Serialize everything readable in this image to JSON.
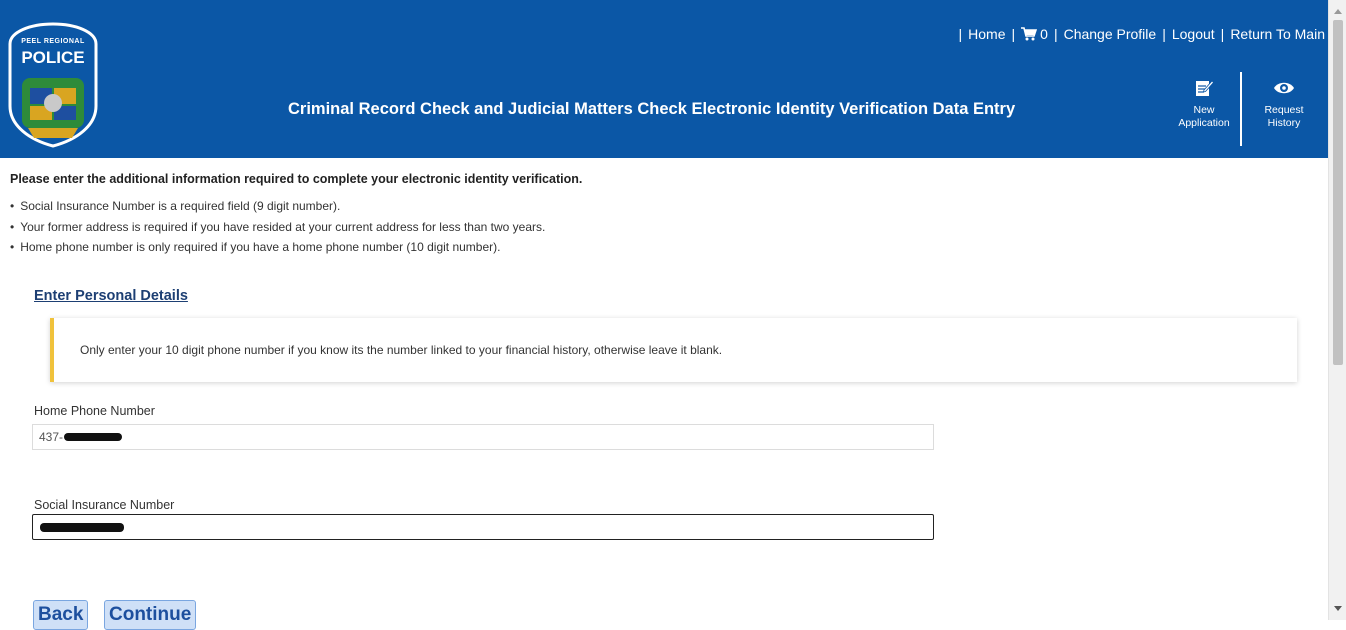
{
  "header": {
    "logo": {
      "top_text": "PEEL REGIONAL",
      "main_text": "POLICE",
      "icon": "police-crest-icon"
    },
    "nav": {
      "home": "Home",
      "cart_count": "0",
      "change_profile": "Change Profile",
      "logout": "Logout",
      "return_main": "Return To Main"
    },
    "title": "Criminal Record Check and Judicial Matters Check Electronic Identity Verification Data Entry",
    "buttons": {
      "new_application": "New Application",
      "request_history": "Request History"
    },
    "colors": {
      "background": "#0b57a6",
      "text": "#ffffff"
    }
  },
  "main": {
    "instruction": "Please enter the additional information required to complete your electronic identity verification.",
    "bullets": [
      "Social Insurance Number is a required field (9 digit number).",
      "Your former address is required if you have resided at your current address for less than two years.",
      "Home phone number is only required if you have a home phone number (10 digit number)."
    ],
    "section_title": "Enter Personal Details",
    "callout": "Only enter your 10 digit phone number if you know its the number linked to your financial history, otherwise leave it blank.",
    "home_phone": {
      "label": "Home Phone Number",
      "value_prefix": "437-"
    },
    "sin": {
      "label": "Social Insurance Number"
    }
  },
  "actions": {
    "back": "Back",
    "continue": "Continue"
  },
  "colors": {
    "accent_callout": "#f0c23b",
    "section_title": "#1d3f73",
    "button_bg": "#cfe0f7"
  }
}
